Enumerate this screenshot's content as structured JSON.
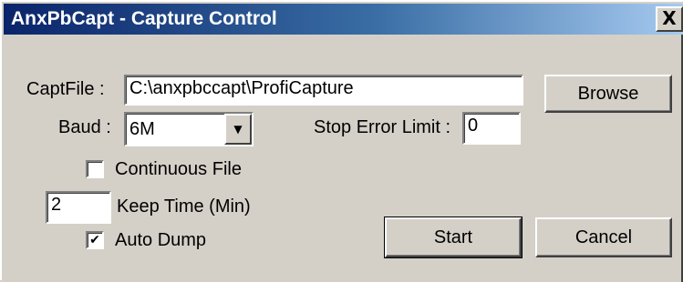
{
  "window": {
    "title": "AnxPbCapt - Capture Control",
    "close_label": "X"
  },
  "capt_file": {
    "label": "CaptFile :",
    "value": "C:\\anxpbccapt\\ProfiCapture"
  },
  "browse_button": "Browse",
  "baud": {
    "label": "Baud :",
    "selected": "6M"
  },
  "stop_error_limit": {
    "label": "Stop Error Limit :",
    "value": "0"
  },
  "continuous_file": {
    "label": "Continuous File",
    "checked": false
  },
  "keep_time": {
    "label": "Keep Time (Min)",
    "value": "2"
  },
  "auto_dump": {
    "label": "Auto Dump",
    "checked": true,
    "check_mark": "✔"
  },
  "start_button": "Start",
  "cancel_button": "Cancel",
  "colors": {
    "titlebar_start": "#0a246a",
    "titlebar_end": "#a6caf0",
    "face": "#d4d0c8"
  }
}
